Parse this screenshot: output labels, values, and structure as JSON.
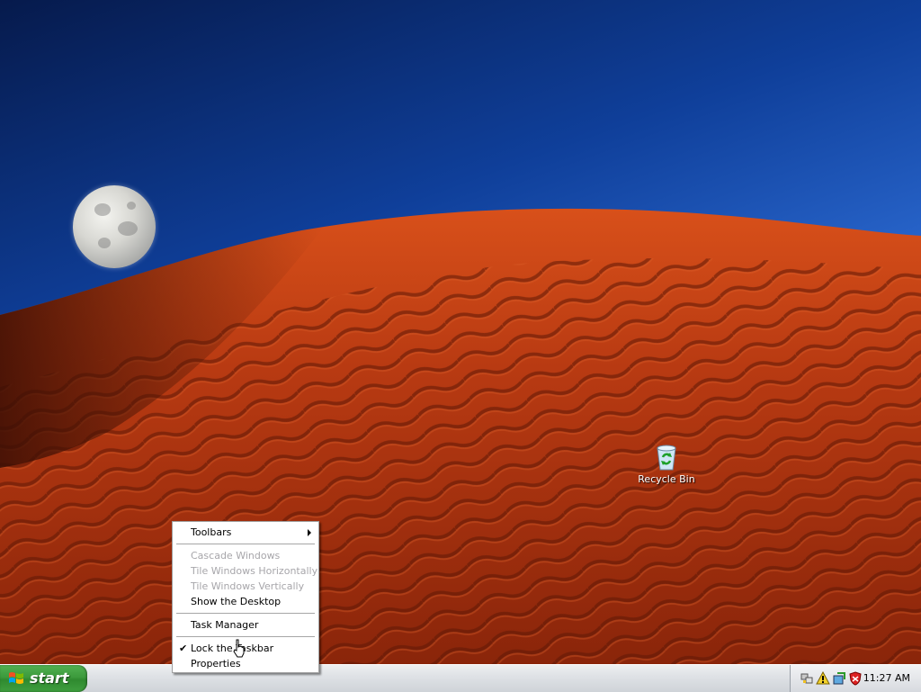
{
  "desktop": {
    "icons": [
      {
        "label": "Recycle Bin",
        "icon": "recycle-bin-icon"
      }
    ]
  },
  "context_menu": {
    "items": [
      {
        "label": "Toolbars",
        "enabled": true,
        "submenu": true
      },
      {
        "label": "Cascade Windows",
        "enabled": false
      },
      {
        "label": "Tile Windows Horizontally",
        "enabled": false
      },
      {
        "label": "Tile Windows Vertically",
        "enabled": false
      },
      {
        "label": "Show the Desktop",
        "enabled": true
      },
      {
        "label": "Task Manager",
        "enabled": true
      },
      {
        "label": "Lock the Taskbar",
        "enabled": true,
        "checked": true
      },
      {
        "label": "Properties",
        "enabled": true
      }
    ],
    "check_glyph": "✔"
  },
  "taskbar": {
    "start_label": "start",
    "tray_icons": [
      "network-icon",
      "security-alert-icon",
      "shield-icon"
    ],
    "clock": "11:27 AM"
  },
  "colors": {
    "sky_dark": "#061a4c",
    "sky_light": "#6aa8f0",
    "dune": "#b83a12",
    "start_green": "#3c9a3c"
  }
}
